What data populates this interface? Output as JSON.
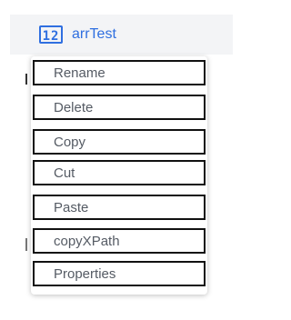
{
  "tree": {
    "node_type_icon": "12",
    "node_label": "arrTest"
  },
  "context_menu": {
    "items": [
      {
        "label": "Rename"
      },
      {
        "label": "Delete"
      },
      {
        "label": "Copy"
      },
      {
        "label": "Cut"
      },
      {
        "label": "Paste"
      },
      {
        "label": "copyXPath"
      },
      {
        "label": "Properties"
      }
    ]
  }
}
